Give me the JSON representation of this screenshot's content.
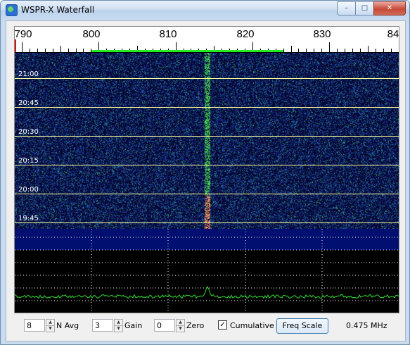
{
  "window": {
    "title": "WSPR-X Waterfall",
    "min_label": "–",
    "max_label": "□",
    "close_label": "✕"
  },
  "scale": {
    "labels": [
      "790",
      "800",
      "810",
      "820",
      "830",
      "84"
    ]
  },
  "waterfall": {
    "time_labels": [
      "21:00",
      "20:45",
      "20:30",
      "20:15",
      "20:00",
      "19:45"
    ]
  },
  "controls": {
    "navg_value": "8",
    "navg_label": "N Avg",
    "gain_value": "3",
    "gain_label": "Gain",
    "zero_value": "0",
    "zero_label": "Zero",
    "cumulative_label": "Cumulative",
    "cumulative_checked": true,
    "freq_scale_button": "Freq Scale",
    "freq_readout": "0.475 MHz"
  },
  "colors": {
    "signal": "#2bbf3a",
    "signal_hot": "#ffb060",
    "trace": "#33dd33",
    "panel_blue": "#000f70"
  }
}
